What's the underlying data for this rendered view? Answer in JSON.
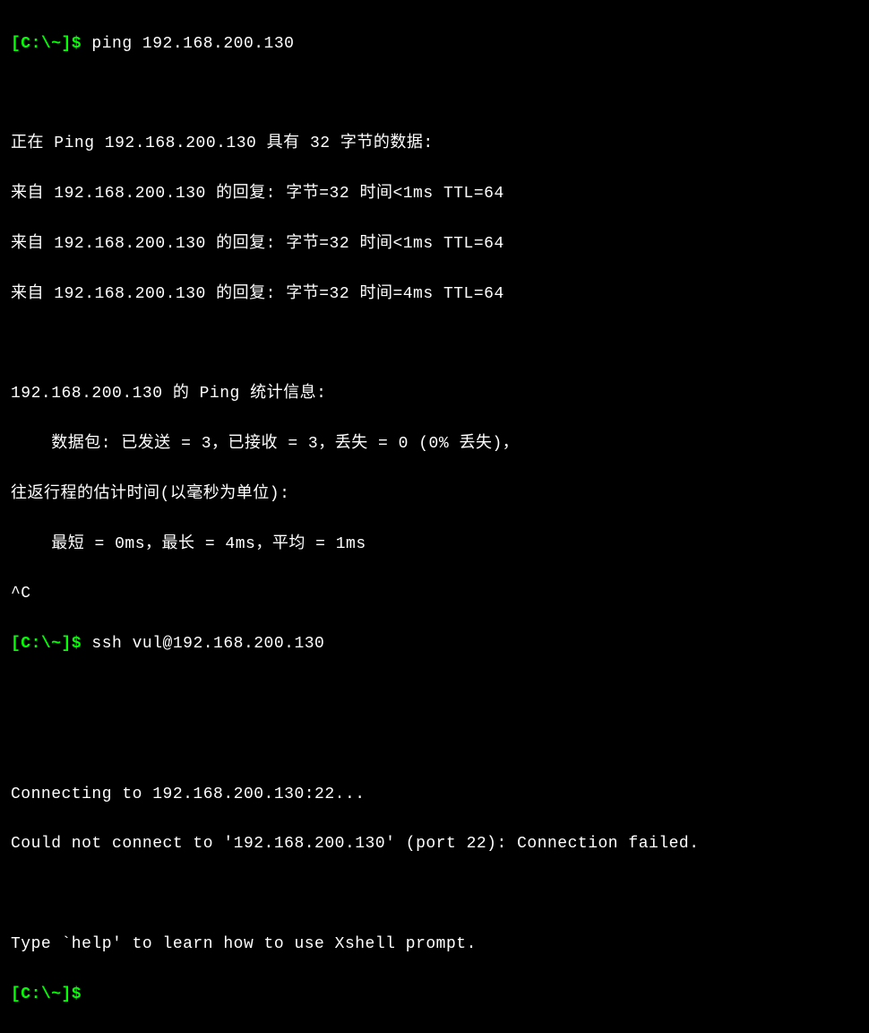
{
  "prompt_text": "[C:\\~]$ ",
  "commands": {
    "ping": "ping 192.168.200.130",
    "ssh": "ssh vul@192.168.200.130",
    "empty": ""
  },
  "ping_output": {
    "header": "正在 Ping 192.168.200.130 具有 32 字节的数据:",
    "reply1": "来自 192.168.200.130 的回复: 字节=32 时间<1ms TTL=64",
    "reply2": "来自 192.168.200.130 的回复: 字节=32 时间<1ms TTL=64",
    "reply3": "来自 192.168.200.130 的回复: 字节=32 时间=4ms TTL=64",
    "stats_header": "192.168.200.130 的 Ping 统计信息:",
    "stats_packets": "    数据包: 已发送 = 3，已接收 = 3，丢失 = 0 (0% 丢失)，",
    "rtt_header": "往返行程的估计时间(以毫秒为单位):",
    "rtt_values": "    最短 = 0ms，最长 = 4ms，平均 = 1ms",
    "interrupt": "^C"
  },
  "ssh_output": {
    "connecting": "Connecting to 192.168.200.130:22...",
    "failed": "Could not connect to '192.168.200.130' (port 22): Connection failed.",
    "help": "Type `help' to learn how to use Xshell prompt."
  }
}
